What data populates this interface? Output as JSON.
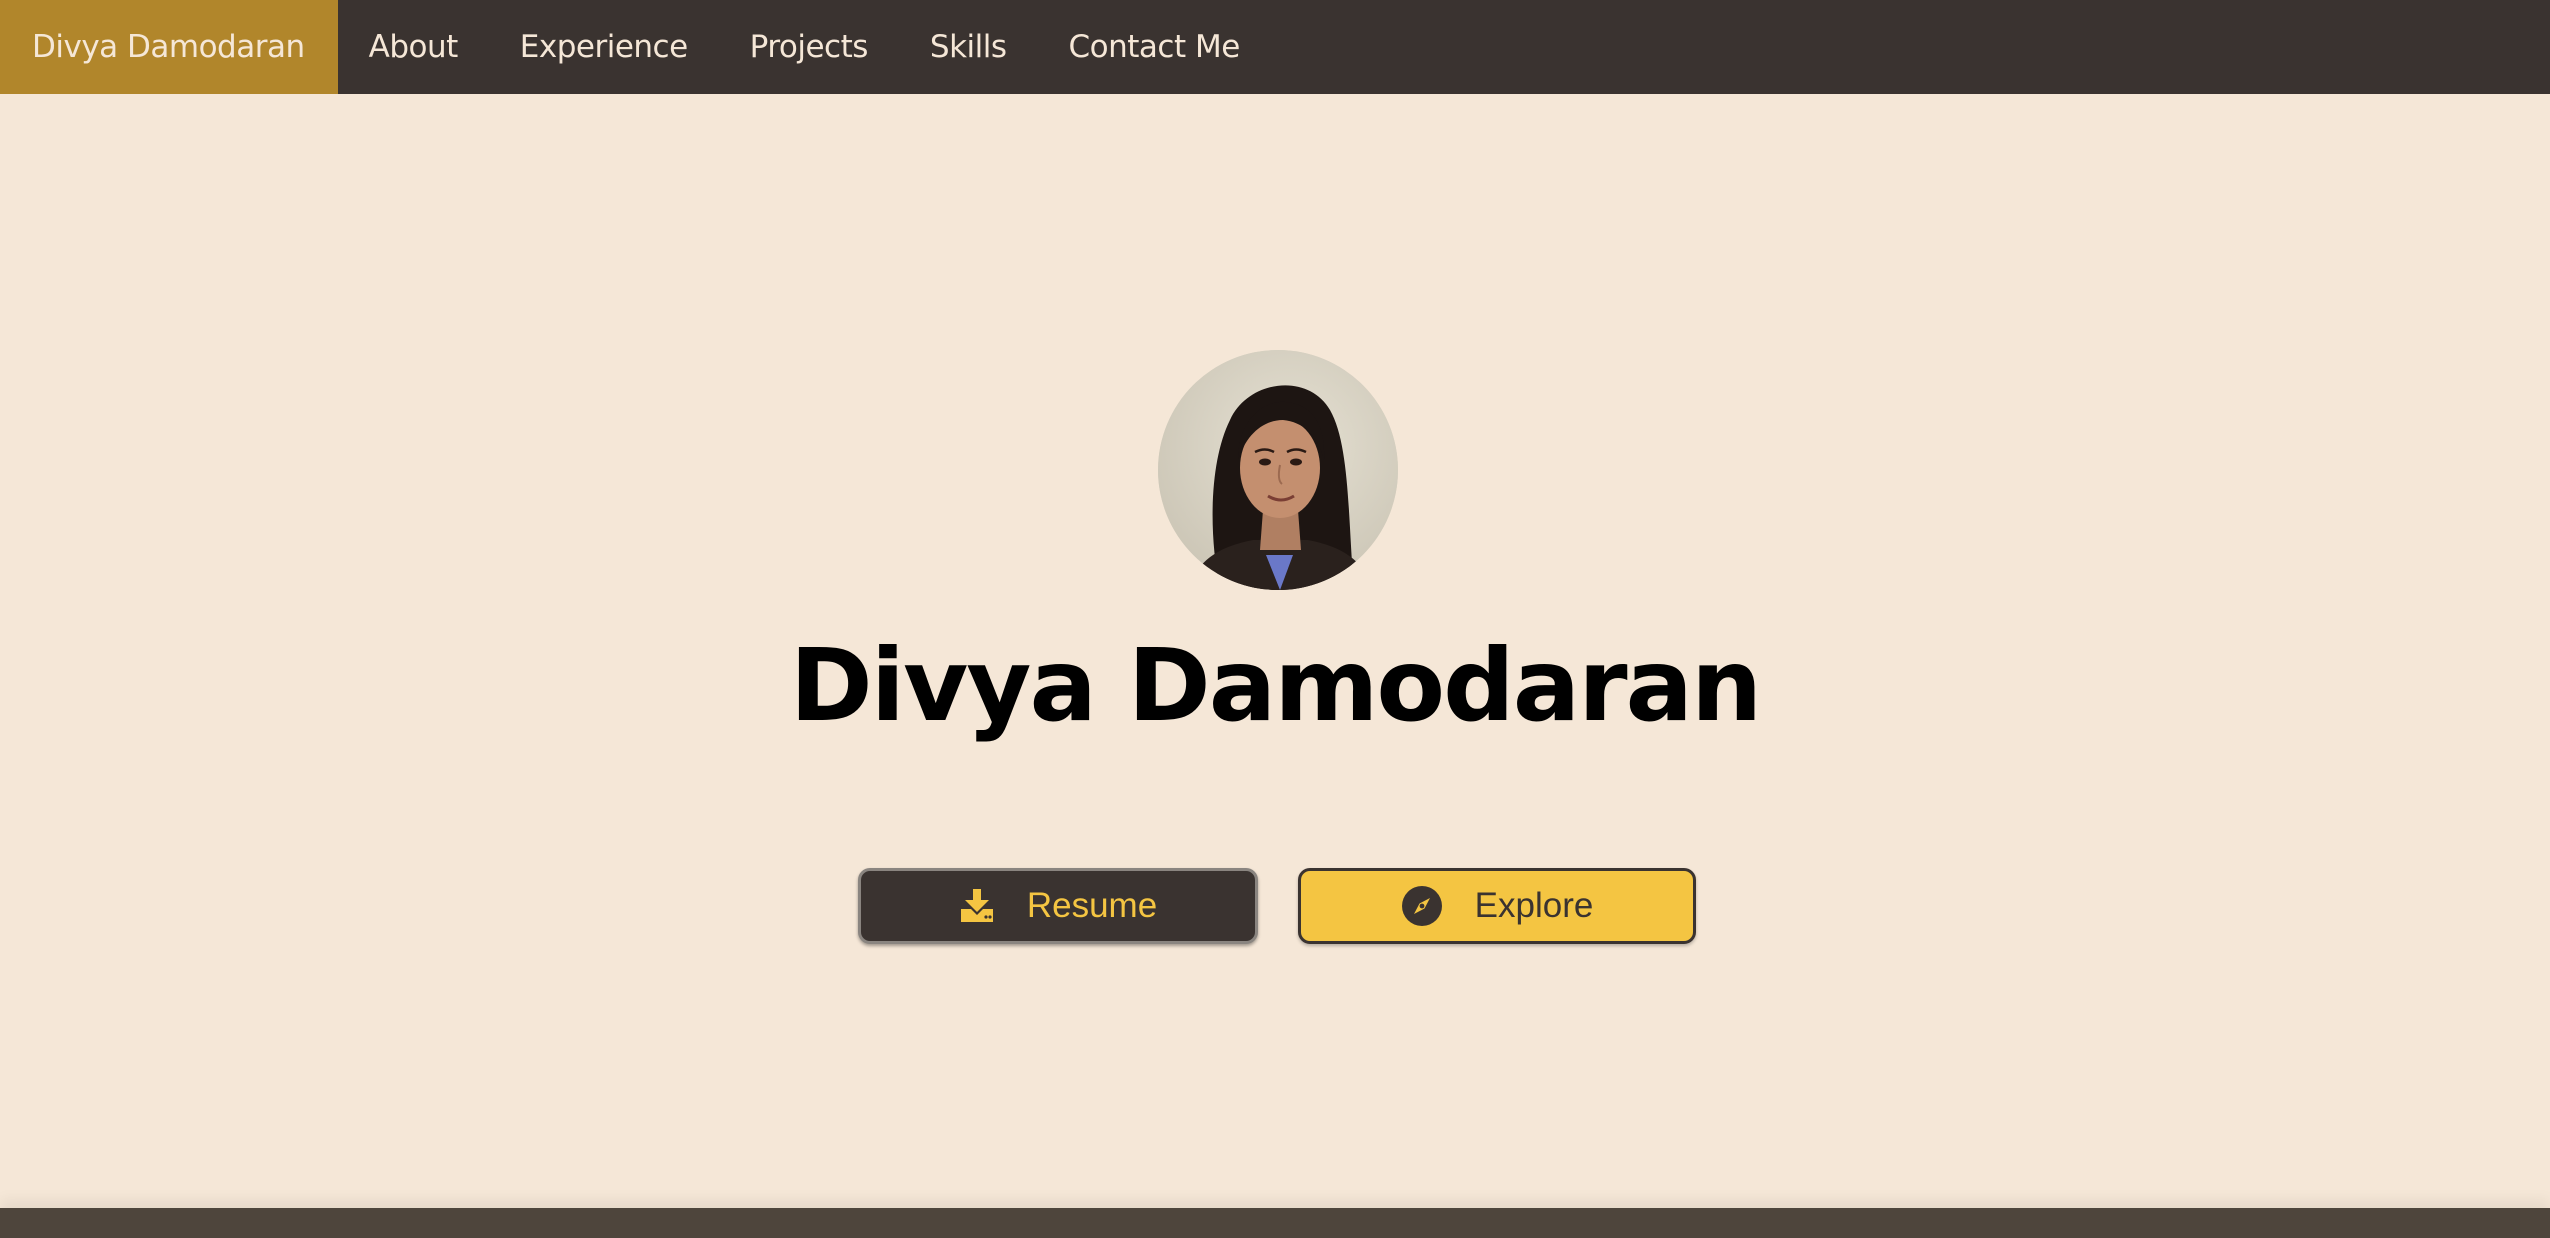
{
  "nav": {
    "brand": "Divya Damodaran",
    "links": [
      "About",
      "Experience",
      "Projects",
      "Skills",
      "Contact Me"
    ]
  },
  "hero": {
    "name": "Divya Damodaran",
    "avatar_alt": "profile photo",
    "resume_label": "Resume",
    "explore_label": "Explore"
  },
  "icons": {
    "resume": "download-icon",
    "explore": "compass-icon"
  },
  "colors": {
    "nav_bg": "#3a3330",
    "brand_bg": "#b1862b",
    "page_bg": "#f5e7d7",
    "accent": "#f4c542"
  }
}
